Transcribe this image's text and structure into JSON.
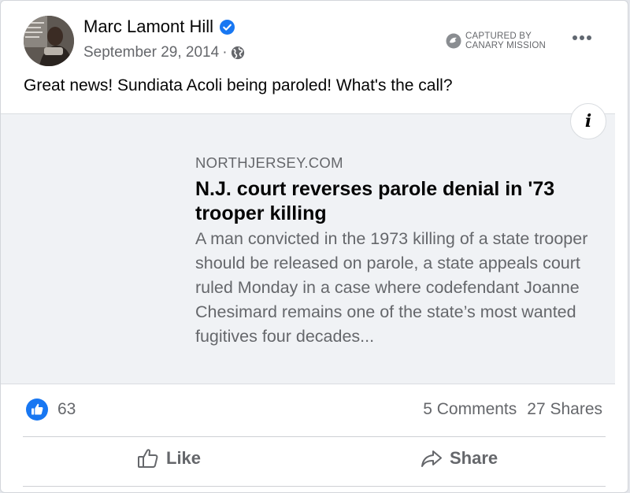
{
  "post": {
    "author": "Marc Lamont Hill",
    "date": "September 29, 2014",
    "separator": "·",
    "text": "Great news! Sundiata Acoli being paroled! What's the call?"
  },
  "watermark": {
    "line1": "CAPTURED BY",
    "line2": "CANARY MISSION"
  },
  "link_preview": {
    "domain": "NORTHJERSEY.COM",
    "title": "N.J. court reverses parole denial in '73 trooper killing",
    "description": "A man convicted in the 1973 killing of a state trooper should be released on parole, a state appeals court ruled Monday in a case where codefendant Joanne Chesimard remains one of the state’s most wanted fugitives four decades...",
    "info_label": "i"
  },
  "engagement": {
    "reaction_count": "63",
    "comments": "5 Comments",
    "shares": "27 Shares"
  },
  "actions": {
    "like": "Like",
    "share": "Share"
  },
  "icons": {
    "verified": "verified-badge-icon",
    "privacy": "globe-icon",
    "more": "more-options-icon",
    "info": "info-icon",
    "reaction": "like-reaction-icon",
    "like": "thumbs-up-icon",
    "share": "share-arrow-icon",
    "watermark": "canary-mission-logo"
  },
  "colors": {
    "brand_blue": "#1877f2",
    "secondary_text": "#65676b",
    "primary_text": "#050505",
    "preview_bg": "#f0f2f5"
  }
}
